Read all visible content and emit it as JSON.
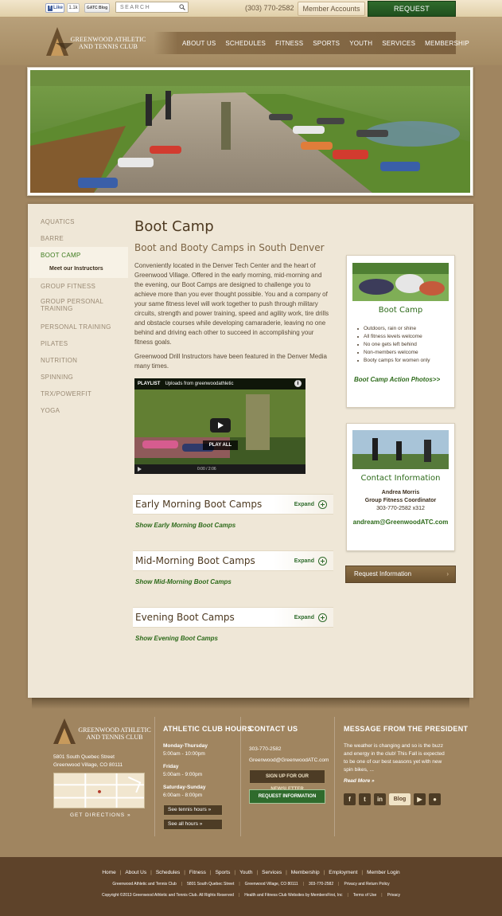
{
  "topbar": {
    "fb_like_label": "Like",
    "fb_count": "1.1k",
    "blog_label": "GATC Blog",
    "search_placeholder": "SEARCH",
    "phone": "(303) 770-2582",
    "member_accounts": "Member Accounts",
    "request_info": "REQUEST INFORMATION"
  },
  "brand": {
    "logo_line1": "GREENWOOD ATHLETIC",
    "logo_line2": "AND TENNIS CLUB"
  },
  "nav": [
    "ABOUT US",
    "SCHEDULES",
    "FITNESS",
    "SPORTS",
    "YOUTH",
    "SERVICES",
    "MEMBERSHIP"
  ],
  "subnav": {
    "items": [
      "AQUATICS",
      "BARRE",
      "BOOT CAMP",
      "GROUP FITNESS",
      "GROUP PERSONAL TRAINING",
      "PERSONAL TRAINING",
      "PILATES",
      "NUTRITION",
      "SPINNING",
      "TRX/POWERFIT",
      "YOGA"
    ],
    "sub_item": "Meet our Instructors"
  },
  "main": {
    "title": "Boot Camp",
    "subtitle": "Boot and Booty Camps in South Denver",
    "paragraph1": "Conveniently located in the Denver Tech Center and the heart of Greenwood Village. Offered in the early morning, mid-morning and the evening, our Boot Camps are designed to challenge you to achieve more than you ever thought possible.  You and a company of your same fitness level will work together to push through military circuits, strength and power training, speed and agility work, tire drills and obstacle courses while developing camaraderie, leaving no one behind and driving each other to succeed in accomplishing your fitness goals.",
    "paragraph2": "Greenwood Drill Instructors have been featured in the Denver Media many times."
  },
  "video": {
    "playlist_label": "PLAYLIST",
    "uploads_label": "Uploads from greenwoodathletic",
    "play_all": "PLAY ALL",
    "time": "0:00 / 2:06"
  },
  "accordions": [
    {
      "title": "Early Morning Boot Camps",
      "expand": "Expand",
      "link": "Show Early Morning Boot Camps"
    },
    {
      "title": "Mid-Morning Boot Camps",
      "expand": "Expand",
      "link": "Show Mid-Morning Boot Camps"
    },
    {
      "title": "Evening Boot Camps",
      "expand": "Expand",
      "link": "Show Evening Boot Camps"
    }
  ],
  "bootcamp_card": {
    "title": "Boot Camp",
    "bullets": [
      "Outdoors, rain or shine",
      "All fitness levels welcome",
      "No one gets left behind",
      "Non-members welcome",
      "Booty camps for women only"
    ],
    "link": "Boot Camp Action Photos>>"
  },
  "contact_card": {
    "title": "Contact Information",
    "name": "Andrea Morris",
    "role": "Group Fitness Coordinator",
    "phone": "303-770-2582 x312",
    "email": "andream@GreenwoodATC.com"
  },
  "side_request": "Request Information",
  "footer": {
    "address_line1": "5801 South Quebec Street",
    "address_line2": "Greenwood Village, CO 80111",
    "directions": "GET DIRECTIONS »",
    "hours_heading": "ATHLETIC CLUB HOURS",
    "hours": [
      {
        "day": "Monday-Thursday",
        "time": "5:00am - 10:00pm"
      },
      {
        "day": "Friday",
        "time": "5:00am - 9:00pm"
      },
      {
        "day": "Saturday-Sunday",
        "time": "6:00am - 8:00pm"
      }
    ],
    "tennis_hours": "See tennis hours »",
    "all_hours": "See all hours »",
    "contact_heading": "CONTACT US",
    "phone": "303-770-2582",
    "email": "Greenwood@GreenwoodATC.com",
    "newsletter": "SIGN UP FOR OUR NEWSLETTER",
    "request": "REQUEST INFORMATION",
    "president_heading": "MESSAGE FROM THE PRESIDENT",
    "president_text": "The weather is changing and so is the buzz and energy in the club! This Fall is expected to be one of our best seasons yet with new spin bikes, ...",
    "read_more": "Read More »",
    "blog_label": "Blog"
  },
  "bottom": {
    "links": [
      "Home",
      "About Us",
      "Schedules",
      "Fitness",
      "Sports",
      "Youth",
      "Services",
      "Membership",
      "Employment",
      "Member Login"
    ],
    "info_line": [
      "Greenwood Athletic and Tennis Club",
      "5801 South Quebec Street",
      "Greenwood Village, CO 80111",
      "303-770-2582",
      "Privacy and Return Policy"
    ],
    "copyright_line": [
      "Copyright ©2013 Greenwood Athletic and Tennis Club. All Rights Reserved",
      "Health and Fitness Club Websites by MembersFirst, Inc",
      "Terms of Use",
      "Privacy"
    ]
  },
  "colors": {
    "brand_green": "#2f6b2c",
    "brand_brown": "#7d6240",
    "background_tan": "#a08560"
  }
}
